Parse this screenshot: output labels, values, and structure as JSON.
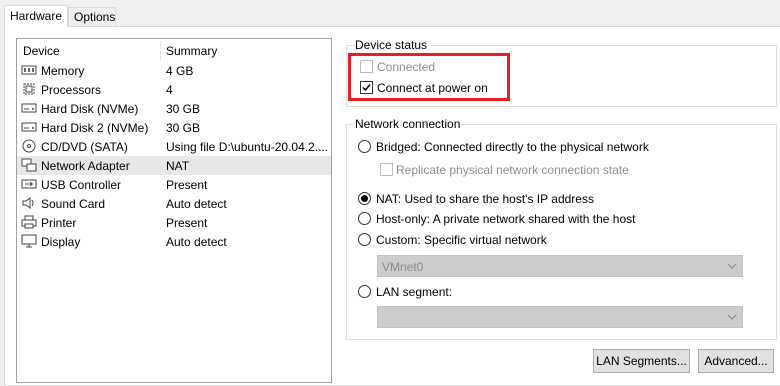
{
  "tabs": [
    {
      "label": "Hardware",
      "active": true
    },
    {
      "label": "Options",
      "active": false
    }
  ],
  "device_list": {
    "header": {
      "device": "Device",
      "summary": "Summary"
    },
    "rows": [
      {
        "name": "Memory",
        "summary": "4 GB",
        "icon": "memory-icon"
      },
      {
        "name": "Processors",
        "summary": "4",
        "icon": "processor-icon"
      },
      {
        "name": "Hard Disk (NVMe)",
        "summary": "30 GB",
        "icon": "hard-disk-icon"
      },
      {
        "name": "Hard Disk 2 (NVMe)",
        "summary": "30 GB",
        "icon": "hard-disk-icon"
      },
      {
        "name": "CD/DVD (SATA)",
        "summary": "Using file D:\\ubuntu-20.04.2....",
        "icon": "cd-dvd-icon"
      },
      {
        "name": "Network Adapter",
        "summary": "NAT",
        "icon": "network-adapter-icon",
        "selected": true
      },
      {
        "name": "USB Controller",
        "summary": "Present",
        "icon": "usb-icon"
      },
      {
        "name": "Sound Card",
        "summary": "Auto detect",
        "icon": "speaker-icon"
      },
      {
        "name": "Printer",
        "summary": "Present",
        "icon": "printer-icon"
      },
      {
        "name": "Display",
        "summary": "Auto detect",
        "icon": "monitor-icon"
      }
    ]
  },
  "device_status": {
    "title": "Device status",
    "connected": {
      "label": "Connected",
      "checked": false,
      "enabled": false
    },
    "connect_at_power_on": {
      "label": "Connect at power on",
      "checked": true,
      "enabled": true
    }
  },
  "network_connection": {
    "title": "Network connection",
    "bridged": {
      "label": "Bridged: Connected directly to the physical network",
      "selected": false
    },
    "replicate": {
      "label": "Replicate physical network connection state",
      "checked": false,
      "enabled": false
    },
    "nat": {
      "label": "NAT: Used to share the host's IP address",
      "selected": true
    },
    "host_only": {
      "label": "Host-only: A private network shared with the host",
      "selected": false
    },
    "custom": {
      "label": "Custom: Specific virtual network",
      "selected": false
    },
    "custom_select": {
      "value": "VMnet0",
      "enabled": false
    },
    "lan_segment": {
      "label": "LAN segment:",
      "selected": false
    },
    "lan_select": {
      "value": "",
      "enabled": false
    }
  },
  "buttons": {
    "lan_segments": "LAN Segments...",
    "advanced": "Advanced..."
  },
  "colors": {
    "highlight": "#e51f24",
    "selected_row": "#e8e8e8",
    "disabled_text": "#8d8d8d"
  }
}
